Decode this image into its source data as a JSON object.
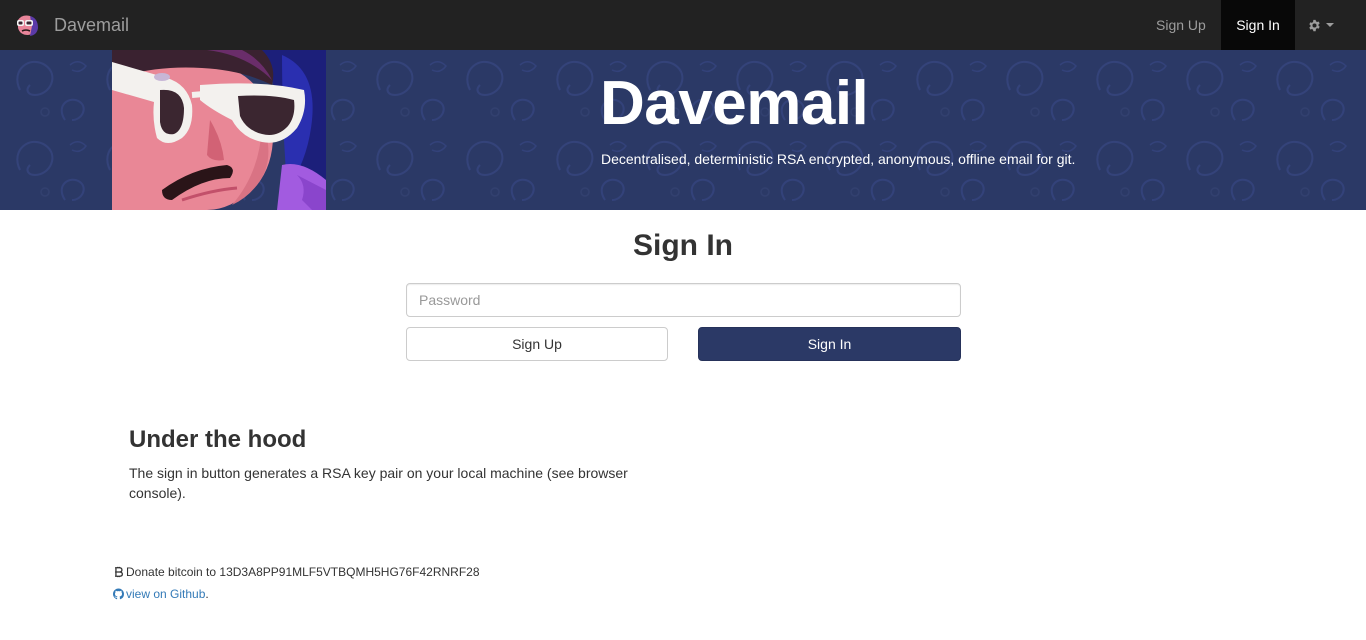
{
  "navbar": {
    "brand_text": "Davemail",
    "links": {
      "signup": "Sign Up",
      "signin": "Sign In"
    },
    "settings_icon": "gear-icon"
  },
  "hero": {
    "title": "Davemail",
    "subtitle": "Decentralised, deterministic RSA encrypted, anonymous, offline email for git."
  },
  "signin_form": {
    "title": "Sign In",
    "password_placeholder": "Password",
    "password_value": "",
    "signup_button": "Sign Up",
    "signin_button": "Sign In"
  },
  "under_the_hood": {
    "title": "Under the hood",
    "text": "The sign in button generates a RSA key pair on your local machine (see browser console)."
  },
  "footer": {
    "donate_prefix": "Donate bitcoin to",
    "bitcoin_address": "13D3A8PP91MLF5VTBQMH5HG76F42RNRF28",
    "github_link": "view on Github",
    "github_suffix": "."
  },
  "colors": {
    "navbar_bg": "#222222",
    "hero_bg": "#2b3966",
    "primary_button": "#2b3966",
    "link": "#337ab7"
  }
}
